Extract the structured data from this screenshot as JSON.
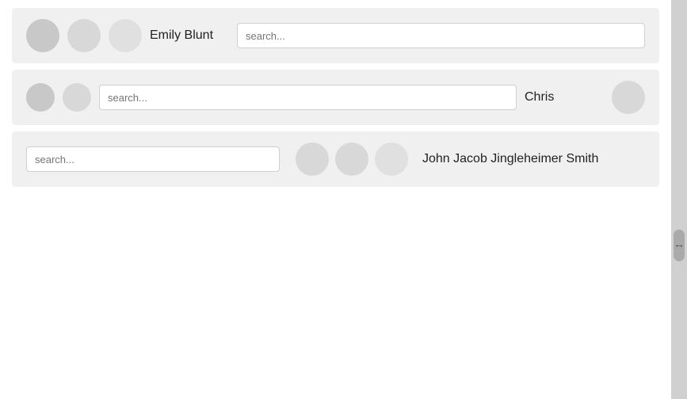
{
  "rows": [
    {
      "id": "row1",
      "avatars": [
        {
          "size": "medium",
          "shade": "dark"
        },
        {
          "size": "medium",
          "shade": "medium"
        },
        {
          "size": "medium",
          "shade": "light"
        }
      ],
      "name": "Emily Blunt",
      "search_placeholder": "search...",
      "search_value": "",
      "name_position": "left"
    },
    {
      "id": "row2",
      "avatars": [
        {
          "size": "small",
          "shade": "dark"
        },
        {
          "size": "small",
          "shade": "medium"
        }
      ],
      "name": "Chris",
      "search_placeholder": "search...",
      "search_value": "",
      "name_position": "right",
      "right_avatar": true
    },
    {
      "id": "row3",
      "avatars": [
        {
          "size": "medium",
          "shade": "medium"
        },
        {
          "size": "medium",
          "shade": "medium"
        },
        {
          "size": "medium",
          "shade": "light"
        }
      ],
      "name": "John Jacob Jingleheimer Smith",
      "search_placeholder": "search...",
      "search_value": "",
      "name_position": "right"
    }
  ],
  "scrollbar": {
    "label": "↔"
  }
}
